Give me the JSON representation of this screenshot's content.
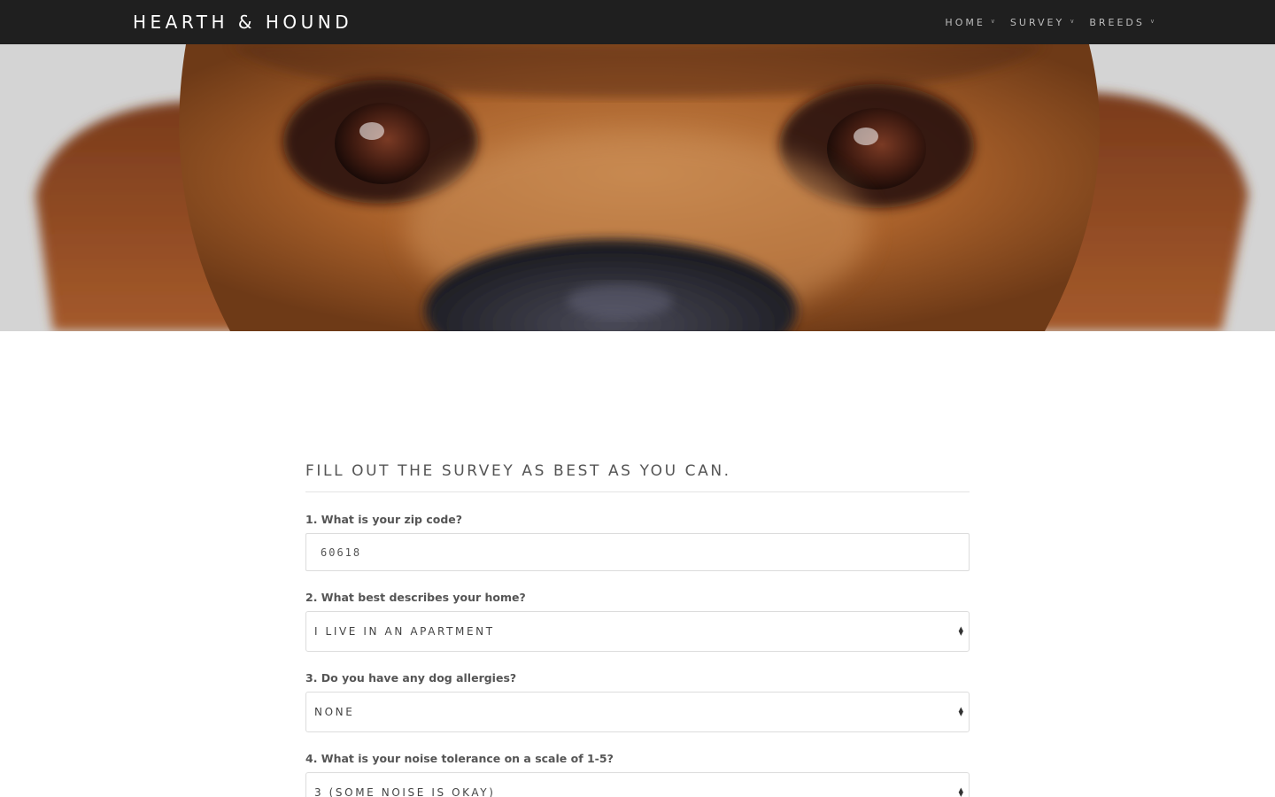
{
  "nav": {
    "brand": "HEARTH & HOUND",
    "items": [
      {
        "label": "HOME",
        "icon": "chevron-down-icon"
      },
      {
        "label": "SURVEY",
        "icon": "chevron-down-icon"
      },
      {
        "label": "BREEDS",
        "icon": "chevron-down-icon"
      }
    ]
  },
  "hero": {
    "image": "dog-closeup-photo"
  },
  "survey": {
    "heading": "FILL OUT THE SURVEY AS BEST AS YOU CAN.",
    "questions": [
      {
        "label": "1. What is your zip code?",
        "type": "text",
        "value": "60618"
      },
      {
        "label": "2. What best describes your home?",
        "type": "select",
        "value": "I LIVE IN AN APARTMENT"
      },
      {
        "label": "3. Do you have any dog allergies?",
        "type": "select",
        "value": "NONE"
      },
      {
        "label": "4. What is your noise tolerance on a scale of 1-5?",
        "type": "select",
        "value": "3 (SOME NOISE IS OKAY)"
      }
    ]
  },
  "colors": {
    "nav_bg": "#1f1f1f",
    "brand_text": "#ffffff",
    "nav_text": "#bdbdbd",
    "body_text": "#555555",
    "field_border": "#dcdcdc"
  }
}
